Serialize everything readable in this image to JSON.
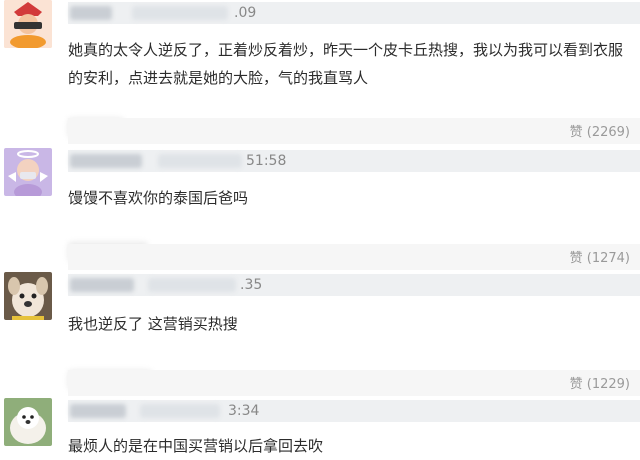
{
  "comments": [
    {
      "time": ".09",
      "text": "她真的太令人逆反了，正着炒反着炒，昨天一个皮卡丘热搜，我以为我可以看到衣服的安利，点进去就是她的大脸，气的我直骂人",
      "like": "赞 (2269)"
    },
    {
      "time": "51:58",
      "text": "馒馒不喜欢你的泰国后爸吗",
      "like": "赞 (1274)"
    },
    {
      "time": ".35",
      "text": "我也逆反了 这营销买热搜",
      "like": "赞 (1229)"
    },
    {
      "time": "3:34",
      "text": "最烦人的是在中国买营销以后拿回去吹"
    }
  ],
  "colors": {
    "meta_bar": "#eef0f2",
    "like_text": "#9a9a9a",
    "body_text": "#2c2c2c"
  }
}
